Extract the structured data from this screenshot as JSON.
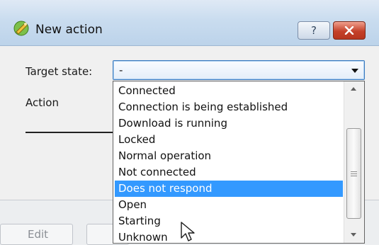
{
  "dialog": {
    "title": "New action",
    "help_label": "?",
    "icon": "new-action-app-icon",
    "close_icon": "close-icon"
  },
  "form": {
    "target_state_label": "Target state:",
    "target_state_value": "-",
    "action_label": "Action"
  },
  "dropdown": {
    "items": [
      {
        "label": "Connected"
      },
      {
        "label": "Connection is being established"
      },
      {
        "label": "Download is running"
      },
      {
        "label": "Locked"
      },
      {
        "label": "Normal operation"
      },
      {
        "label": "Not connected"
      },
      {
        "label": "Does not respond",
        "selected": true
      },
      {
        "label": "Open"
      },
      {
        "label": "Starting"
      },
      {
        "label": "Unknown"
      }
    ],
    "highlight_color": "#3399ff"
  },
  "footer": {
    "edit_label": "Edit"
  }
}
